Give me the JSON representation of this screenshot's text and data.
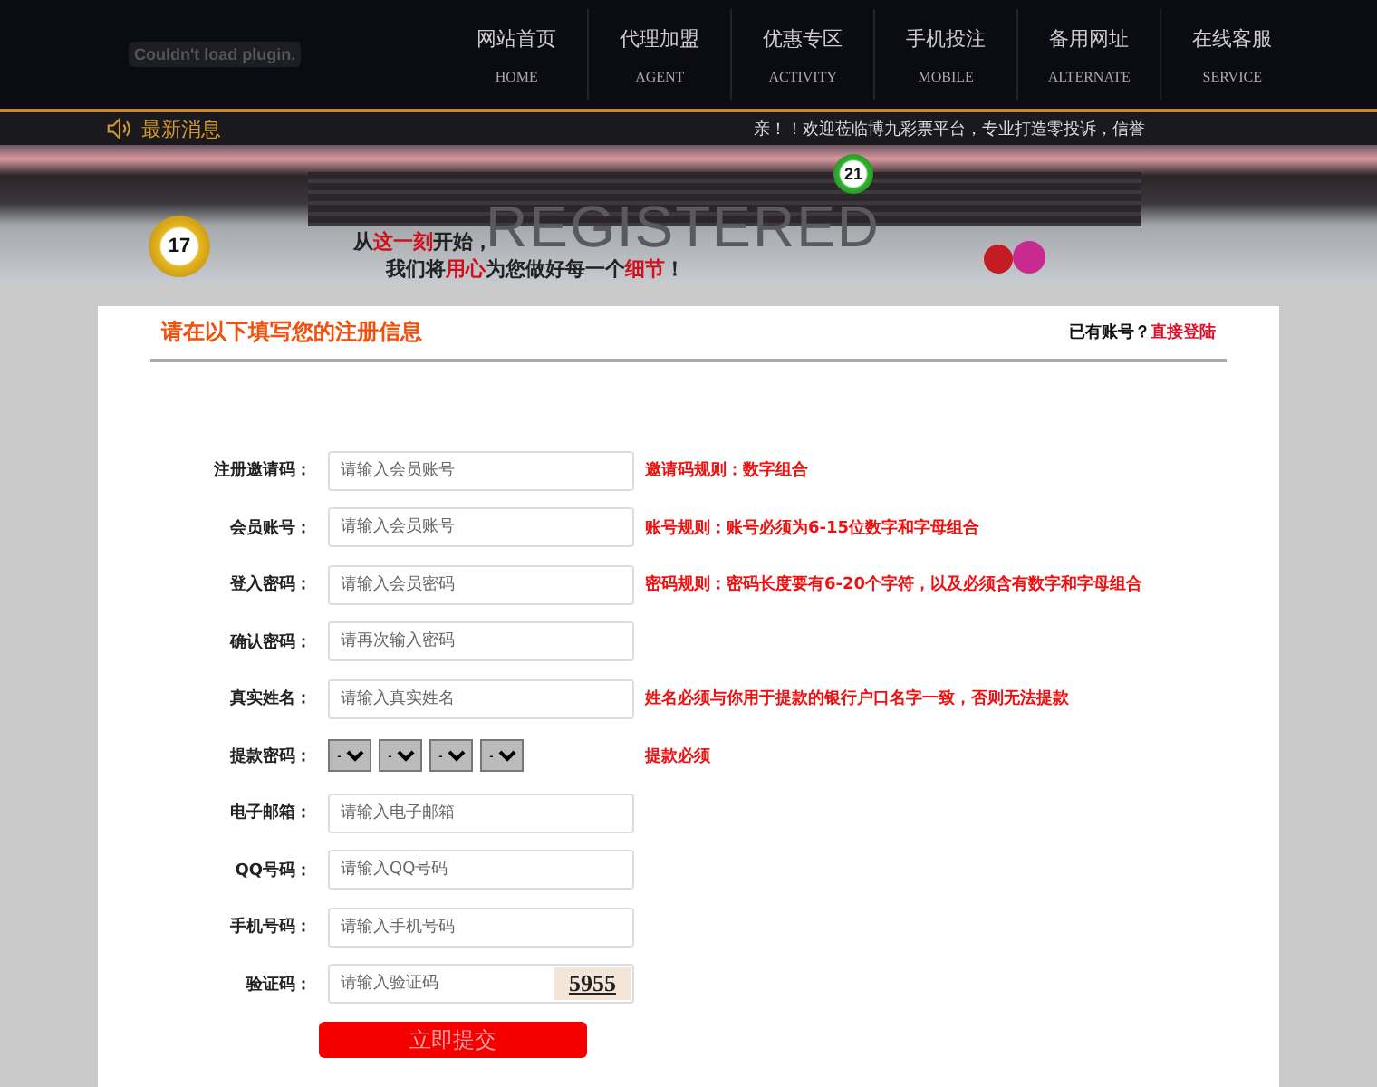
{
  "header": {
    "plugin_notice": "Couldn't load plugin.",
    "nav": [
      {
        "label": "网站首页",
        "sub": "HOME"
      },
      {
        "label": "代理加盟",
        "sub": "AGENT"
      },
      {
        "label": "优惠专区",
        "sub": "ACTIVITY"
      },
      {
        "label": "手机投注",
        "sub": "MOBILE"
      },
      {
        "label": "备用网址",
        "sub": "ALTERNATE"
      },
      {
        "label": "在线客服",
        "sub": "SERVICE"
      }
    ]
  },
  "news": {
    "label": "最新消息",
    "marquee": "亲！！欢迎莅临博九彩票平台，专业打造零投诉，信誉"
  },
  "banner": {
    "watermark": "REGISTERED",
    "line_1": "从**这一刻**开始，",
    "line_2": "我们将**用心**为您做好每一个**细节**！",
    "balls": [
      "17",
      "21"
    ]
  },
  "form": {
    "title": "请在以下填写您的注册信息",
    "login_prompt": "已有账号？",
    "login_link": "直接登陆",
    "fields": [
      {
        "kind": "text",
        "label": "注册邀请码：",
        "placeholder": "请输入会员账号",
        "hint": "邀请码规则：数字组合"
      },
      {
        "kind": "text",
        "label": "会员账号：",
        "placeholder": "请输入会员账号",
        "hint": "账号规则：账号必须为6-15位数字和字母组合"
      },
      {
        "kind": "text",
        "label": "登入密码：",
        "placeholder": "请输入会员密码",
        "hint": "密码规则：密码长度要有6-20个字符，以及必须含有数字和字母组合"
      },
      {
        "kind": "text",
        "label": "确认密码：",
        "placeholder": "请再次输入密码"
      },
      {
        "kind": "text",
        "label": "真实姓名：",
        "placeholder": "请输入真实姓名",
        "hint": "姓名必须与你用于提款的银行户口名字一致，否则无法提款"
      },
      {
        "kind": "selects",
        "label": "提款密码：",
        "options": [
          "-",
          "-",
          "-",
          "-"
        ],
        "hint": "提款必须"
      },
      {
        "kind": "text",
        "label": "电子邮箱：",
        "placeholder": "请输入电子邮箱"
      },
      {
        "kind": "text",
        "label": "QQ号码：",
        "placeholder": "请输入QQ号码"
      },
      {
        "kind": "text",
        "label": "手机号码：",
        "placeholder": "请输入手机号码"
      },
      {
        "kind": "captcha",
        "label": "验证码：",
        "placeholder": "请输入验证码",
        "captcha": "5955"
      }
    ],
    "submit": "立即提交"
  }
}
